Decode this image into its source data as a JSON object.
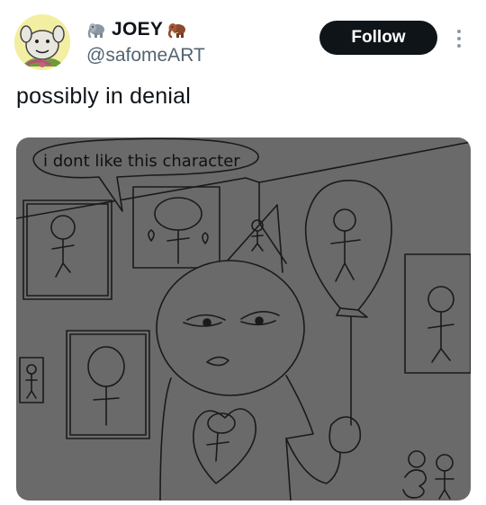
{
  "author": {
    "display_name": "JOEY",
    "handle": "@safomeART",
    "name_emojis": [
      "elephant-emoji",
      "mammoth-emoji"
    ],
    "avatar": "monster-avatar"
  },
  "actions": {
    "follow_label": "Follow",
    "more_icon": "more-vertical-icon"
  },
  "post": {
    "text": "possibly in denial"
  },
  "media": {
    "speech_bubble_text": "i dont like this character"
  },
  "colors": {
    "follow_bg": "#0f1419",
    "handle": "#536471",
    "drawing_bg": "#6a6a6a"
  }
}
